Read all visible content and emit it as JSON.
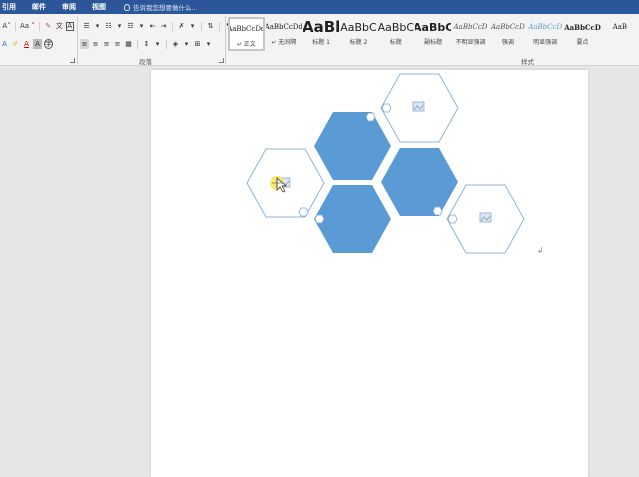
{
  "menu": {
    "items": [
      "引用",
      "邮件",
      "审阅",
      "视图"
    ],
    "tell_me": "告诉我您想要做什么..."
  },
  "ribbon": {
    "font_row1": [
      "A˄",
      "Aa ˅",
      "A̶",
      "文",
      "A"
    ],
    "paragraph_group_label": "段落",
    "styles_group_label": "样式",
    "styles": [
      {
        "sample": "AaBbCcDd",
        "name": "↵ 正文",
        "size": 7,
        "selected": true
      },
      {
        "sample": "AaBbCcDd",
        "name": "↵ 无间隔",
        "size": 7
      },
      {
        "sample": "AaBl",
        "name": "标题 1",
        "size": 15
      },
      {
        "sample": "AaBbC",
        "name": "标题 2",
        "size": 11
      },
      {
        "sample": "AaBbC",
        "name": "标题",
        "size": 11
      },
      {
        "sample": "AaBbC",
        "name": "副标题",
        "size": 11
      },
      {
        "sample": "AaBbCcD",
        "name": "不明显强调",
        "size": 7
      },
      {
        "sample": "AaBbCcD",
        "name": "强调",
        "size": 7
      },
      {
        "sample": "AaBbCcD",
        "name": "明显强调",
        "size": 7
      },
      {
        "sample": "AaBbCcD",
        "name": "要点",
        "size": 7
      },
      {
        "sample": "AaB",
        "name": "",
        "size": 7
      }
    ]
  },
  "colors": {
    "accent": "#2b579a",
    "hex_fill": "#5b9bd5",
    "hex_outline": "#8fb3d9"
  }
}
